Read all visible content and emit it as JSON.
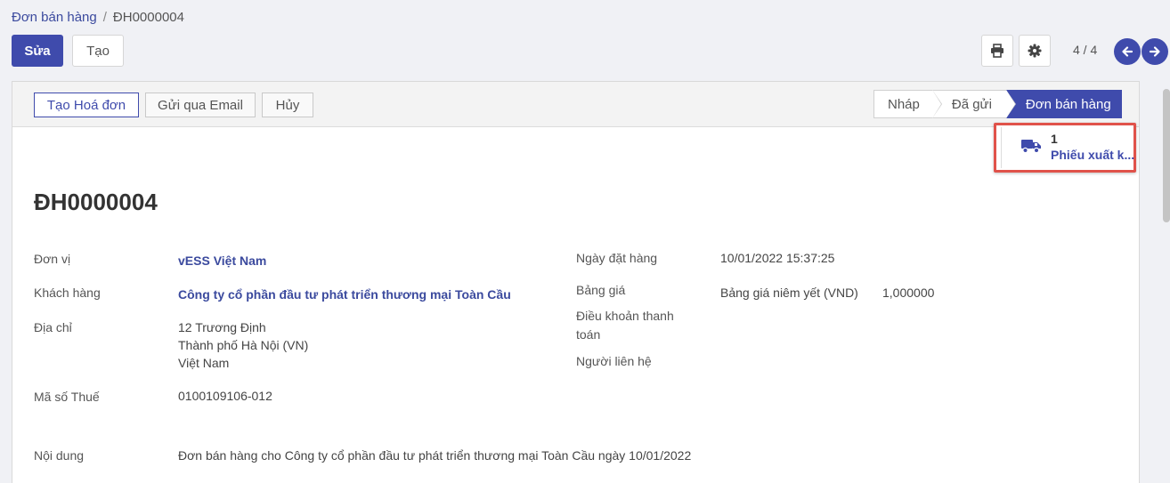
{
  "breadcrumb": {
    "parent": "Đơn bán hàng",
    "separator": "/",
    "current": "ĐH0000004"
  },
  "toolbar": {
    "edit_label": "Sửa",
    "create_label": "Tạo",
    "print_icon": "printer-icon",
    "settings_icon": "gear-icon"
  },
  "pager": {
    "value": "4 / 4",
    "prev_icon": "arrow-left-icon",
    "next_icon": "arrow-right-icon"
  },
  "status_actions": {
    "create_invoice": "Tạo Hoá đơn",
    "send_email": "Gửi qua Email",
    "cancel": "Hủy"
  },
  "stages": {
    "draft": "Nháp",
    "sent": "Đã gửi",
    "sale_order": "Đơn bán hàng",
    "active": "Đơn bán hàng"
  },
  "smart_button": {
    "count": "1",
    "label": "Phiếu xuất k...",
    "icon": "truck-icon"
  },
  "record": {
    "name": "ĐH0000004",
    "company_label": "Đơn vị",
    "company": "vESS Việt Nam",
    "customer_label": "Khách hàng",
    "customer": "Công ty cổ phần đầu tư phát triển thương mại Toàn Cầu",
    "address_label": "Địa chỉ",
    "address_line1": "12 Trương Định",
    "address_line2": "Thành phố Hà Nội (VN)",
    "address_line3": "Việt Nam",
    "tax_label": "Mã số Thuế",
    "tax": "0100109106-012",
    "order_date_label": "Ngày đặt hàng",
    "order_date": "10/01/2022 15:37:25",
    "pricelist_label": "Bảng giá",
    "pricelist": "Bảng giá niêm yết (VND)",
    "pricelist_rate": "1,000000",
    "payment_terms_label_1": "Điều khoản thanh",
    "payment_terms_label_2": "toán",
    "contact_label": "Người liên hệ",
    "content_label": "Nội dung",
    "content": "Đơn bán hàng cho Công ty cổ phần đầu tư phát triển thương mại Toàn Cầu ngày 10/01/2022"
  },
  "colors": {
    "primary": "#3f4bac",
    "highlight": "#e0524a"
  }
}
